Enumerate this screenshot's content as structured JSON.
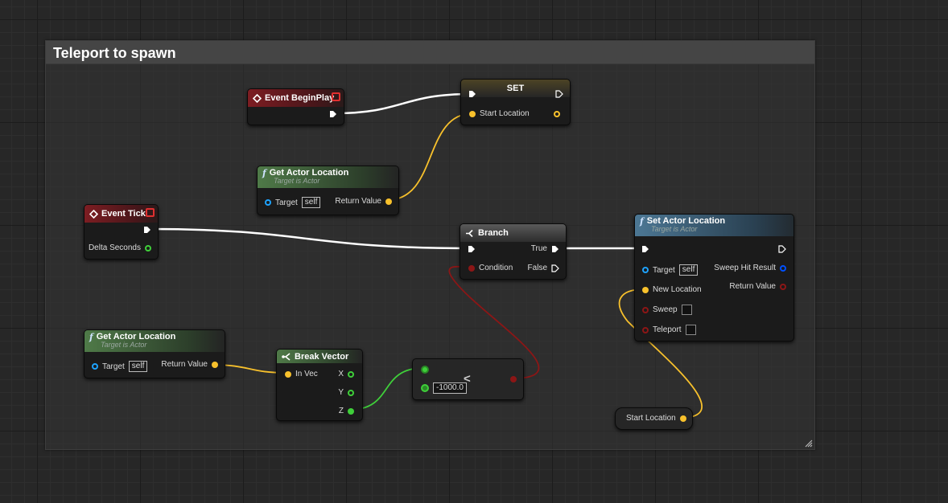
{
  "comment": {
    "title": "Teleport to spawn"
  },
  "colors": {
    "exec": "#ffffff",
    "vector": "#f8c12c",
    "float": "#3fcf3a",
    "bool": "#8c1616",
    "object": "#1ea3ff",
    "struct": "#0050ff"
  },
  "nodes": {
    "event_begin_play": {
      "title": "Event BeginPlay"
    },
    "set_node": {
      "title": "SET",
      "var_label": "Start Location"
    },
    "get_actor_location_top": {
      "title": "Get Actor Location",
      "subtitle": "Target is Actor",
      "target_label": "Target",
      "target_value": "self",
      "return_label": "Return Value"
    },
    "event_tick": {
      "title": "Event Tick",
      "delta_label": "Delta Seconds"
    },
    "branch": {
      "title": "Branch",
      "true_label": "True",
      "false_label": "False",
      "condition_label": "Condition"
    },
    "set_actor_location": {
      "title": "Set Actor Location",
      "subtitle": "Target is Actor",
      "target_label": "Target",
      "target_value": "self",
      "new_location_label": "New Location",
      "sweep_label": "Sweep",
      "teleport_label": "Teleport",
      "sweep_hit_label": "Sweep Hit Result",
      "return_label": "Return Value"
    },
    "get_actor_location_bottom": {
      "title": "Get Actor Location",
      "subtitle": "Target is Actor",
      "target_label": "Target",
      "target_value": "self",
      "return_label": "Return Value"
    },
    "break_vector": {
      "title": "Break Vector",
      "in_label": "In Vec",
      "x_label": "X",
      "y_label": "Y",
      "z_label": "Z"
    },
    "less_than": {
      "operator": "<",
      "b_value": "-1000.0"
    },
    "start_location_getter": {
      "label": "Start Location"
    }
  }
}
